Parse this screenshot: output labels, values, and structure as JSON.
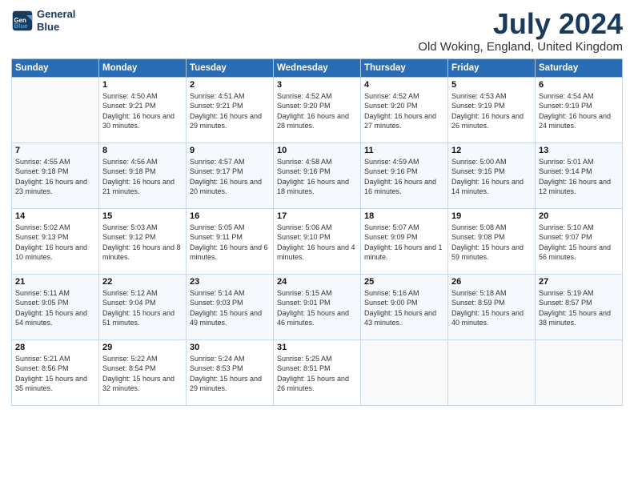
{
  "header": {
    "logo_line1": "General",
    "logo_line2": "Blue",
    "title": "July 2024",
    "location": "Old Woking, England, United Kingdom"
  },
  "weekdays": [
    "Sunday",
    "Monday",
    "Tuesday",
    "Wednesday",
    "Thursday",
    "Friday",
    "Saturday"
  ],
  "weeks": [
    [
      {
        "day": "",
        "sunrise": "",
        "sunset": "",
        "daylight": ""
      },
      {
        "day": "1",
        "sunrise": "Sunrise: 4:50 AM",
        "sunset": "Sunset: 9:21 PM",
        "daylight": "Daylight: 16 hours and 30 minutes."
      },
      {
        "day": "2",
        "sunrise": "Sunrise: 4:51 AM",
        "sunset": "Sunset: 9:21 PM",
        "daylight": "Daylight: 16 hours and 29 minutes."
      },
      {
        "day": "3",
        "sunrise": "Sunrise: 4:52 AM",
        "sunset": "Sunset: 9:20 PM",
        "daylight": "Daylight: 16 hours and 28 minutes."
      },
      {
        "day": "4",
        "sunrise": "Sunrise: 4:52 AM",
        "sunset": "Sunset: 9:20 PM",
        "daylight": "Daylight: 16 hours and 27 minutes."
      },
      {
        "day": "5",
        "sunrise": "Sunrise: 4:53 AM",
        "sunset": "Sunset: 9:19 PM",
        "daylight": "Daylight: 16 hours and 26 minutes."
      },
      {
        "day": "6",
        "sunrise": "Sunrise: 4:54 AM",
        "sunset": "Sunset: 9:19 PM",
        "daylight": "Daylight: 16 hours and 24 minutes."
      }
    ],
    [
      {
        "day": "7",
        "sunrise": "Sunrise: 4:55 AM",
        "sunset": "Sunset: 9:18 PM",
        "daylight": "Daylight: 16 hours and 23 minutes."
      },
      {
        "day": "8",
        "sunrise": "Sunrise: 4:56 AM",
        "sunset": "Sunset: 9:18 PM",
        "daylight": "Daylight: 16 hours and 21 minutes."
      },
      {
        "day": "9",
        "sunrise": "Sunrise: 4:57 AM",
        "sunset": "Sunset: 9:17 PM",
        "daylight": "Daylight: 16 hours and 20 minutes."
      },
      {
        "day": "10",
        "sunrise": "Sunrise: 4:58 AM",
        "sunset": "Sunset: 9:16 PM",
        "daylight": "Daylight: 16 hours and 18 minutes."
      },
      {
        "day": "11",
        "sunrise": "Sunrise: 4:59 AM",
        "sunset": "Sunset: 9:16 PM",
        "daylight": "Daylight: 16 hours and 16 minutes."
      },
      {
        "day": "12",
        "sunrise": "Sunrise: 5:00 AM",
        "sunset": "Sunset: 9:15 PM",
        "daylight": "Daylight: 16 hours and 14 minutes."
      },
      {
        "day": "13",
        "sunrise": "Sunrise: 5:01 AM",
        "sunset": "Sunset: 9:14 PM",
        "daylight": "Daylight: 16 hours and 12 minutes."
      }
    ],
    [
      {
        "day": "14",
        "sunrise": "Sunrise: 5:02 AM",
        "sunset": "Sunset: 9:13 PM",
        "daylight": "Daylight: 16 hours and 10 minutes."
      },
      {
        "day": "15",
        "sunrise": "Sunrise: 5:03 AM",
        "sunset": "Sunset: 9:12 PM",
        "daylight": "Daylight: 16 hours and 8 minutes."
      },
      {
        "day": "16",
        "sunrise": "Sunrise: 5:05 AM",
        "sunset": "Sunset: 9:11 PM",
        "daylight": "Daylight: 16 hours and 6 minutes."
      },
      {
        "day": "17",
        "sunrise": "Sunrise: 5:06 AM",
        "sunset": "Sunset: 9:10 PM",
        "daylight": "Daylight: 16 hours and 4 minutes."
      },
      {
        "day": "18",
        "sunrise": "Sunrise: 5:07 AM",
        "sunset": "Sunset: 9:09 PM",
        "daylight": "Daylight: 16 hours and 1 minute."
      },
      {
        "day": "19",
        "sunrise": "Sunrise: 5:08 AM",
        "sunset": "Sunset: 9:08 PM",
        "daylight": "Daylight: 15 hours and 59 minutes."
      },
      {
        "day": "20",
        "sunrise": "Sunrise: 5:10 AM",
        "sunset": "Sunset: 9:07 PM",
        "daylight": "Daylight: 15 hours and 56 minutes."
      }
    ],
    [
      {
        "day": "21",
        "sunrise": "Sunrise: 5:11 AM",
        "sunset": "Sunset: 9:05 PM",
        "daylight": "Daylight: 15 hours and 54 minutes."
      },
      {
        "day": "22",
        "sunrise": "Sunrise: 5:12 AM",
        "sunset": "Sunset: 9:04 PM",
        "daylight": "Daylight: 15 hours and 51 minutes."
      },
      {
        "day": "23",
        "sunrise": "Sunrise: 5:14 AM",
        "sunset": "Sunset: 9:03 PM",
        "daylight": "Daylight: 15 hours and 49 minutes."
      },
      {
        "day": "24",
        "sunrise": "Sunrise: 5:15 AM",
        "sunset": "Sunset: 9:01 PM",
        "daylight": "Daylight: 15 hours and 46 minutes."
      },
      {
        "day": "25",
        "sunrise": "Sunrise: 5:16 AM",
        "sunset": "Sunset: 9:00 PM",
        "daylight": "Daylight: 15 hours and 43 minutes."
      },
      {
        "day": "26",
        "sunrise": "Sunrise: 5:18 AM",
        "sunset": "Sunset: 8:59 PM",
        "daylight": "Daylight: 15 hours and 40 minutes."
      },
      {
        "day": "27",
        "sunrise": "Sunrise: 5:19 AM",
        "sunset": "Sunset: 8:57 PM",
        "daylight": "Daylight: 15 hours and 38 minutes."
      }
    ],
    [
      {
        "day": "28",
        "sunrise": "Sunrise: 5:21 AM",
        "sunset": "Sunset: 8:56 PM",
        "daylight": "Daylight: 15 hours and 35 minutes."
      },
      {
        "day": "29",
        "sunrise": "Sunrise: 5:22 AM",
        "sunset": "Sunset: 8:54 PM",
        "daylight": "Daylight: 15 hours and 32 minutes."
      },
      {
        "day": "30",
        "sunrise": "Sunrise: 5:24 AM",
        "sunset": "Sunset: 8:53 PM",
        "daylight": "Daylight: 15 hours and 29 minutes."
      },
      {
        "day": "31",
        "sunrise": "Sunrise: 5:25 AM",
        "sunset": "Sunset: 8:51 PM",
        "daylight": "Daylight: 15 hours and 26 minutes."
      },
      {
        "day": "",
        "sunrise": "",
        "sunset": "",
        "daylight": ""
      },
      {
        "day": "",
        "sunrise": "",
        "sunset": "",
        "daylight": ""
      },
      {
        "day": "",
        "sunrise": "",
        "sunset": "",
        "daylight": ""
      }
    ]
  ]
}
